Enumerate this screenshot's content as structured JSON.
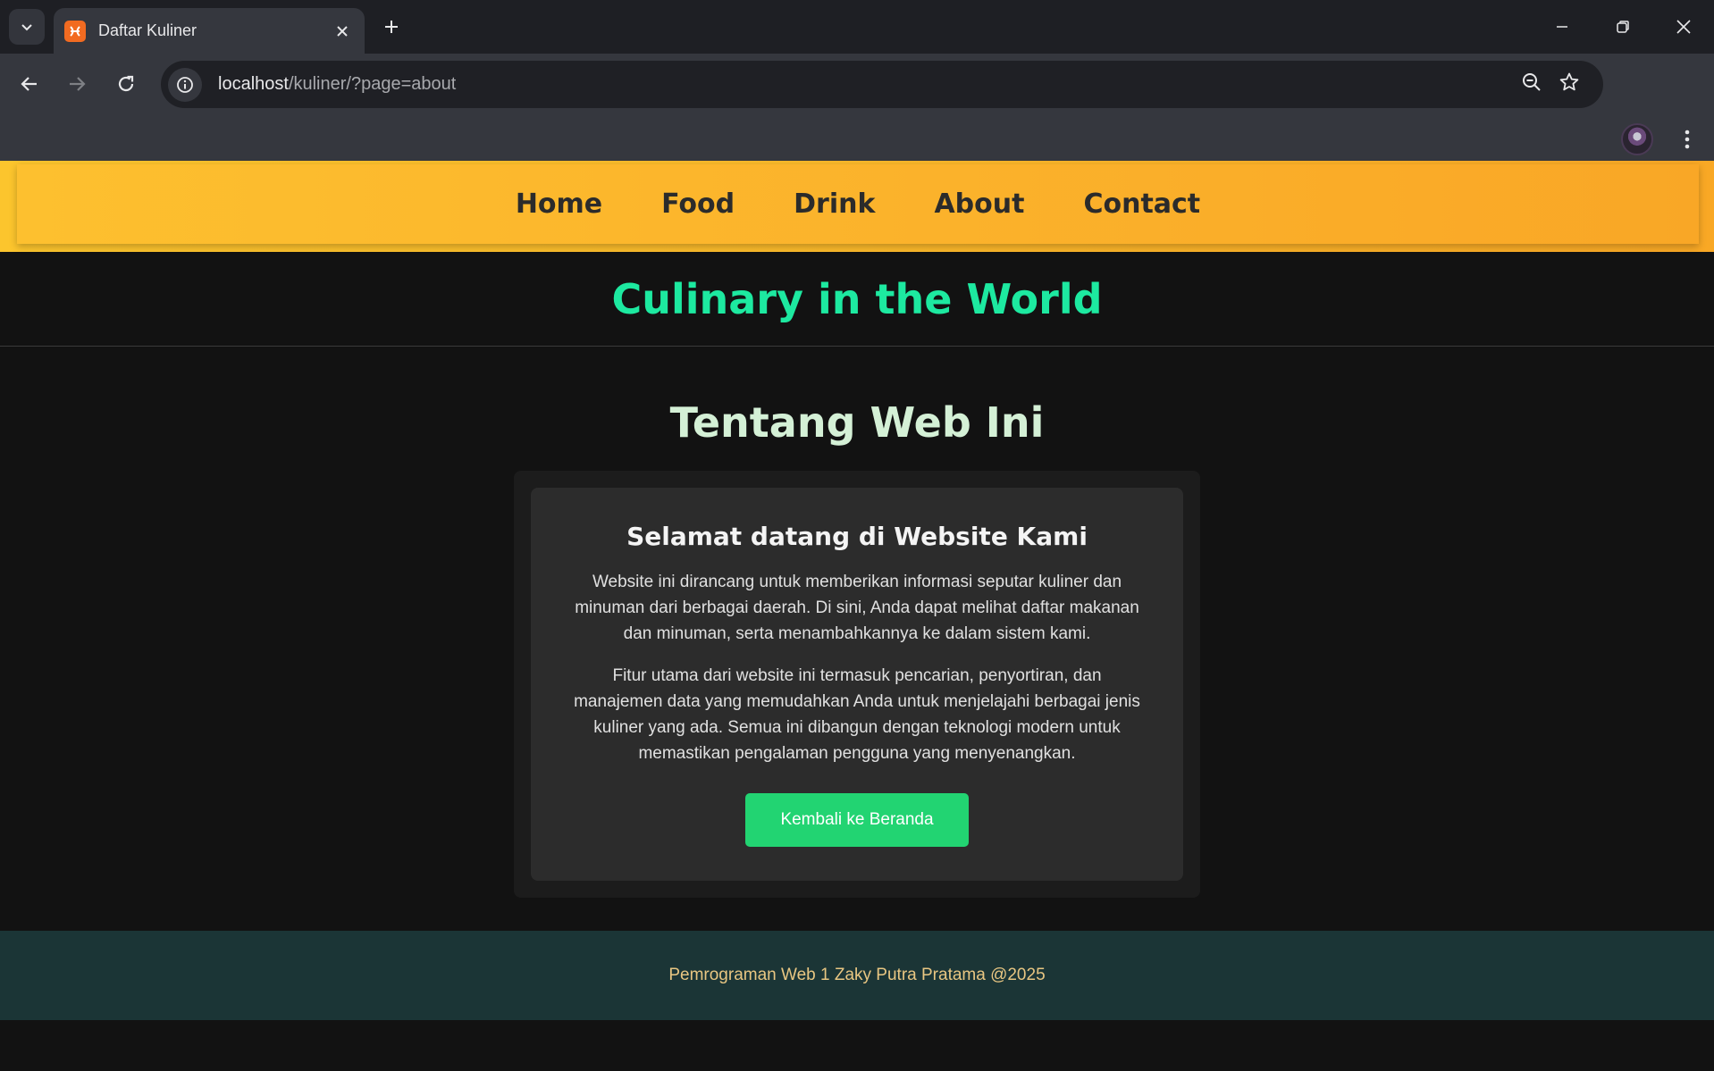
{
  "browser": {
    "tab_title": "Daftar Kuliner",
    "url_host": "localhost",
    "url_path": "/kuliner/?page=about"
  },
  "nav": {
    "links": [
      "Home",
      "Food",
      "Drink",
      "About",
      "Contact"
    ]
  },
  "header": {
    "title": "Culinary in the World"
  },
  "main": {
    "title": "Tentang Web Ini",
    "card": {
      "title": "Selamat datang di Website Kami",
      "paragraph1": "Website ini dirancang untuk memberikan informasi seputar kuliner dan minuman dari berbagai daerah. Di sini, Anda dapat melihat daftar makanan dan minuman, serta menambahkannya ke dalam sistem kami.",
      "paragraph2": "Fitur utama dari website ini termasuk pencarian, penyortiran, dan manajemen data yang memudahkan Anda untuk menjelajahi berbagai jenis kuliner yang ada. Semua ini dibangun dengan teknologi modern untuk memastikan pengalaman pengguna yang menyenangkan.",
      "button_label": "Kembali ke Beranda"
    }
  },
  "footer": {
    "text": "Pemrograman Web 1 Zaky Putra Pratama @2025"
  },
  "colors": {
    "nav_bg": "#fbb92a",
    "hero_title": "#1de9a0",
    "section_title": "#d4f0d6",
    "button": "#22d472",
    "footer_bg": "#1b3536",
    "footer_text": "#e8c682"
  }
}
